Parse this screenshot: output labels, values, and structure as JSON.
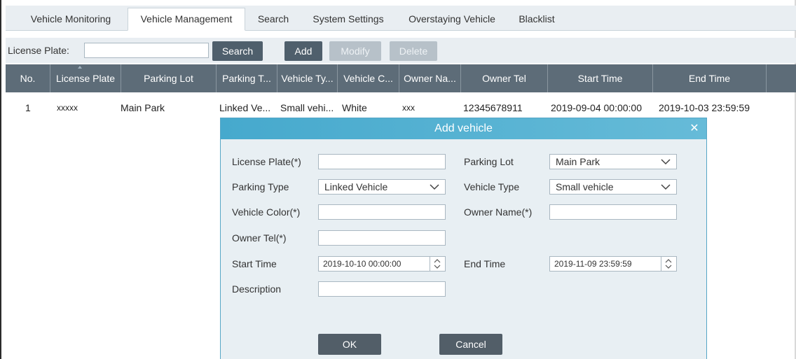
{
  "tabs": [
    "Vehicle Monitoring",
    "Vehicle Management",
    "Search",
    "System Settings",
    "Overstaying Vehicle",
    "Blacklist"
  ],
  "search": {
    "label": "License Plate:",
    "value": "",
    "search_label": "Search",
    "add_label": "Add",
    "modify_label": "Modify",
    "delete_label": "Delete"
  },
  "table": {
    "headers": [
      "No.",
      "License Plate",
      "Parking Lot",
      "Parking T...",
      "Vehicle Ty...",
      "Vehicle C...",
      "Owner Na...",
      "Owner Tel",
      "Start Time",
      "End Time"
    ],
    "rows": [
      [
        "1",
        "xxxxx",
        "Main Park",
        "Linked Ve...",
        "Small vehi...",
        "White",
        "xxx",
        "12345678911",
        "2019-09-04 00:00:00",
        "2019-10-03 23:59:59"
      ]
    ]
  },
  "dialog": {
    "title": "Add vehicle",
    "license_plate_label": "License Plate(*)",
    "license_plate_value": "",
    "parking_lot_label": "Parking Lot",
    "parking_lot_value": "Main Park",
    "parking_type_label": "Parking Type",
    "parking_type_value": "Linked Vehicle",
    "vehicle_type_label": "Vehicle Type",
    "vehicle_type_value": "Small vehicle",
    "vehicle_color_label": "Vehicle Color(*)",
    "vehicle_color_value": "",
    "owner_name_label": "Owner Name(*)",
    "owner_name_value": "",
    "owner_tel_label": "Owner Tel(*)",
    "owner_tel_value": "",
    "start_time_label": "Start Time",
    "start_time_value": "2019-10-10 00:00:00",
    "end_time_label": "End Time",
    "end_time_value": "2019-11-09 23:59:59",
    "description_label": "Description",
    "description_value": "",
    "ok_label": "OK",
    "cancel_label": "Cancel"
  },
  "colors": {
    "header_bg": "#5d6c78",
    "dialog_title_bg": "#46a9cd",
    "dark_button": "#4f5f6c"
  }
}
